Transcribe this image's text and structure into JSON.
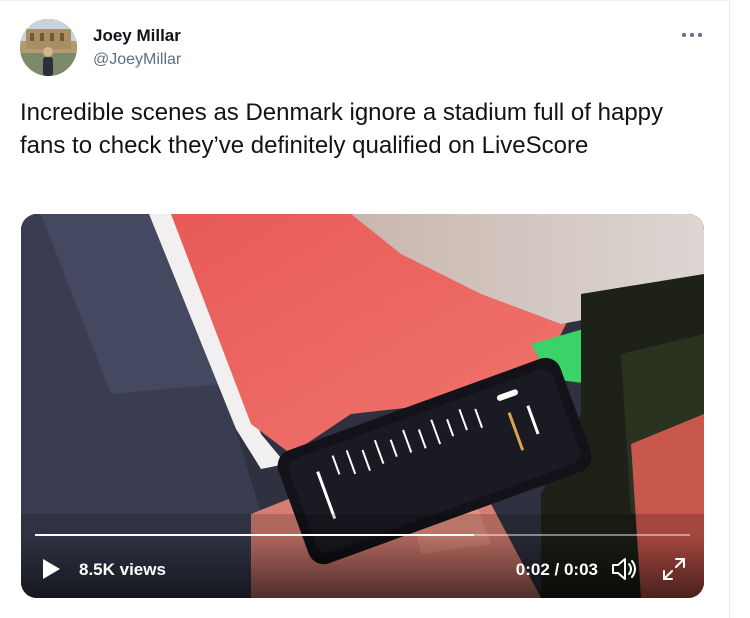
{
  "tweet": {
    "author_name": "Joey Millar",
    "author_handle": "@JoeyMillar",
    "text": "Incredible scenes as Denmark ignore a stadium full of happy fans to check they’ve definitely qualified on LiveScore"
  },
  "video": {
    "views_label": "8.5K views",
    "time_label": "0:02 / 0:03",
    "progress": 0.67
  },
  "icons": {
    "more": "more-horizontal-icon",
    "play": "play-icon",
    "volume": "volume-icon",
    "fullscreen": "fullscreen-icon"
  },
  "colors": {
    "text": "#0f1419",
    "secondary": "#5b7083",
    "controls": "#ffffff"
  }
}
